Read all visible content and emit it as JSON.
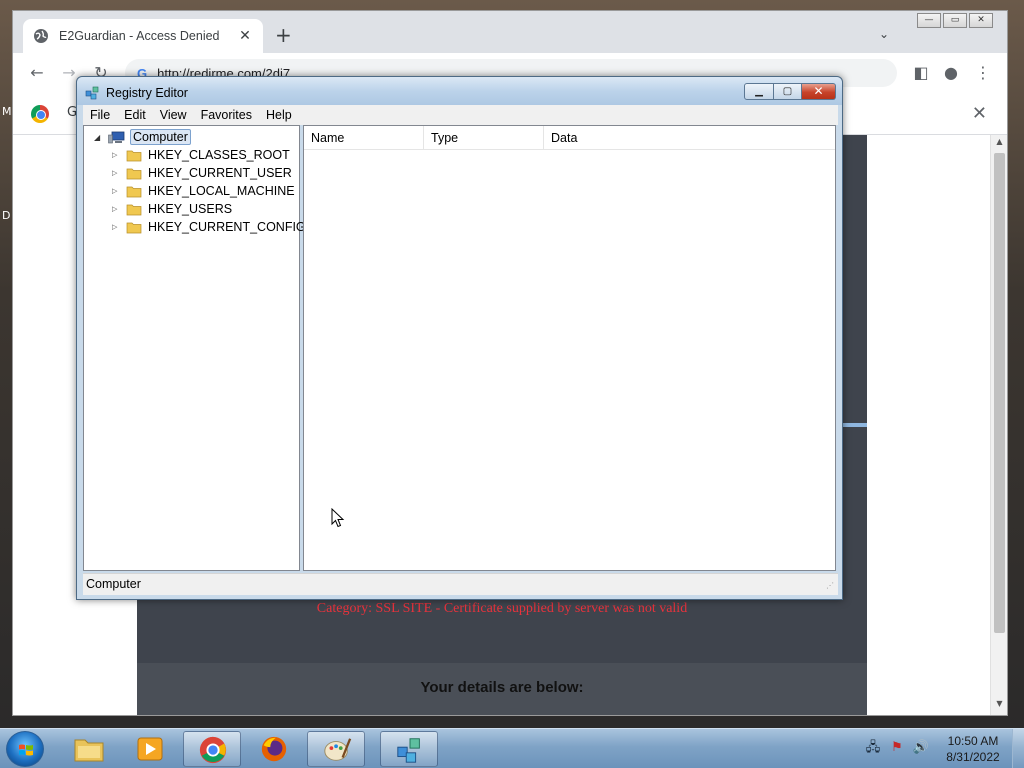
{
  "desktop": {
    "left_letter_1": "M",
    "left_letter_2": "D"
  },
  "browser": {
    "tab_title": "E2Guardian - Access Denied",
    "tab_close": "✕",
    "new_tab": "+",
    "tab_search": "⌄",
    "url": "http://redirme.com/2di7",
    "bookmark_letter": "G",
    "infobar_close": "✕",
    "window_controls": {
      "minimize": "—",
      "maximize": "▭",
      "close": "✕"
    },
    "toolbar": {
      "back": "←",
      "forward": "→",
      "reload": "↻",
      "sidepanel": "◧",
      "profile": "●",
      "menu": "⋮"
    }
  },
  "page": {
    "category_line": "Category: SSL SITE - Certificate supplied by server was not valid",
    "details_heading": "Your details are below:"
  },
  "regedit": {
    "title": "Registry Editor",
    "menu": [
      "File",
      "Edit",
      "View",
      "Favorites",
      "Help"
    ],
    "tree_root": "Computer",
    "tree_items": [
      "HKEY_CLASSES_ROOT",
      "HKEY_CURRENT_USER",
      "HKEY_LOCAL_MACHINE",
      "HKEY_USERS",
      "HKEY_CURRENT_CONFIG"
    ],
    "columns": [
      "Name",
      "Type",
      "Data"
    ],
    "status": "Computer",
    "controls": {
      "minimize": "▁",
      "maximize": "▢",
      "close": "✕"
    }
  },
  "taskbar": {
    "time": "10:50 AM",
    "date": "8/31/2022",
    "apps": [
      "explorer",
      "media-player",
      "chrome",
      "firefox",
      "paint",
      "regedit"
    ]
  },
  "colors": {
    "error_text": "#e8323c",
    "taskbar": "#7fa3c6",
    "page_dark": "#3f444d"
  }
}
